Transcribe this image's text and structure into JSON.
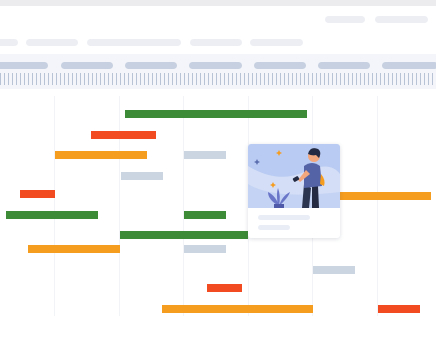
{
  "colors": {
    "task_green": "#3d8b37",
    "task_red": "#f24b22",
    "task_orange": "#f59d1f",
    "task_grey": "#cbd4e1",
    "placeholder": "#eceef3",
    "header_band": "#f3f5fa",
    "illustration_bg": "#b9cbf2"
  },
  "timeline": {
    "tasks": [
      {
        "name": "task-green-1",
        "color": "green"
      },
      {
        "name": "task-red-1",
        "color": "red"
      },
      {
        "name": "task-orange-1",
        "color": "orange"
      },
      {
        "name": "task-grey-1",
        "color": "grey"
      },
      {
        "name": "task-grey-2",
        "color": "grey"
      },
      {
        "name": "task-red-2",
        "color": "red"
      },
      {
        "name": "task-orange-2",
        "color": "orange"
      },
      {
        "name": "task-green-2",
        "color": "green"
      },
      {
        "name": "task-green-3",
        "color": "green"
      },
      {
        "name": "task-green-4",
        "color": "green"
      },
      {
        "name": "task-orange-3",
        "color": "orange"
      },
      {
        "name": "task-grey-3",
        "color": "grey"
      },
      {
        "name": "task-grey-4",
        "color": "grey"
      },
      {
        "name": "task-red-3",
        "color": "red"
      },
      {
        "name": "task-orange-4",
        "color": "orange"
      },
      {
        "name": "task-red-4",
        "color": "red"
      }
    ]
  },
  "card": {
    "illustration": "person-with-phone-illustration",
    "icons": [
      "sparkle-icon",
      "plant-icon"
    ]
  }
}
